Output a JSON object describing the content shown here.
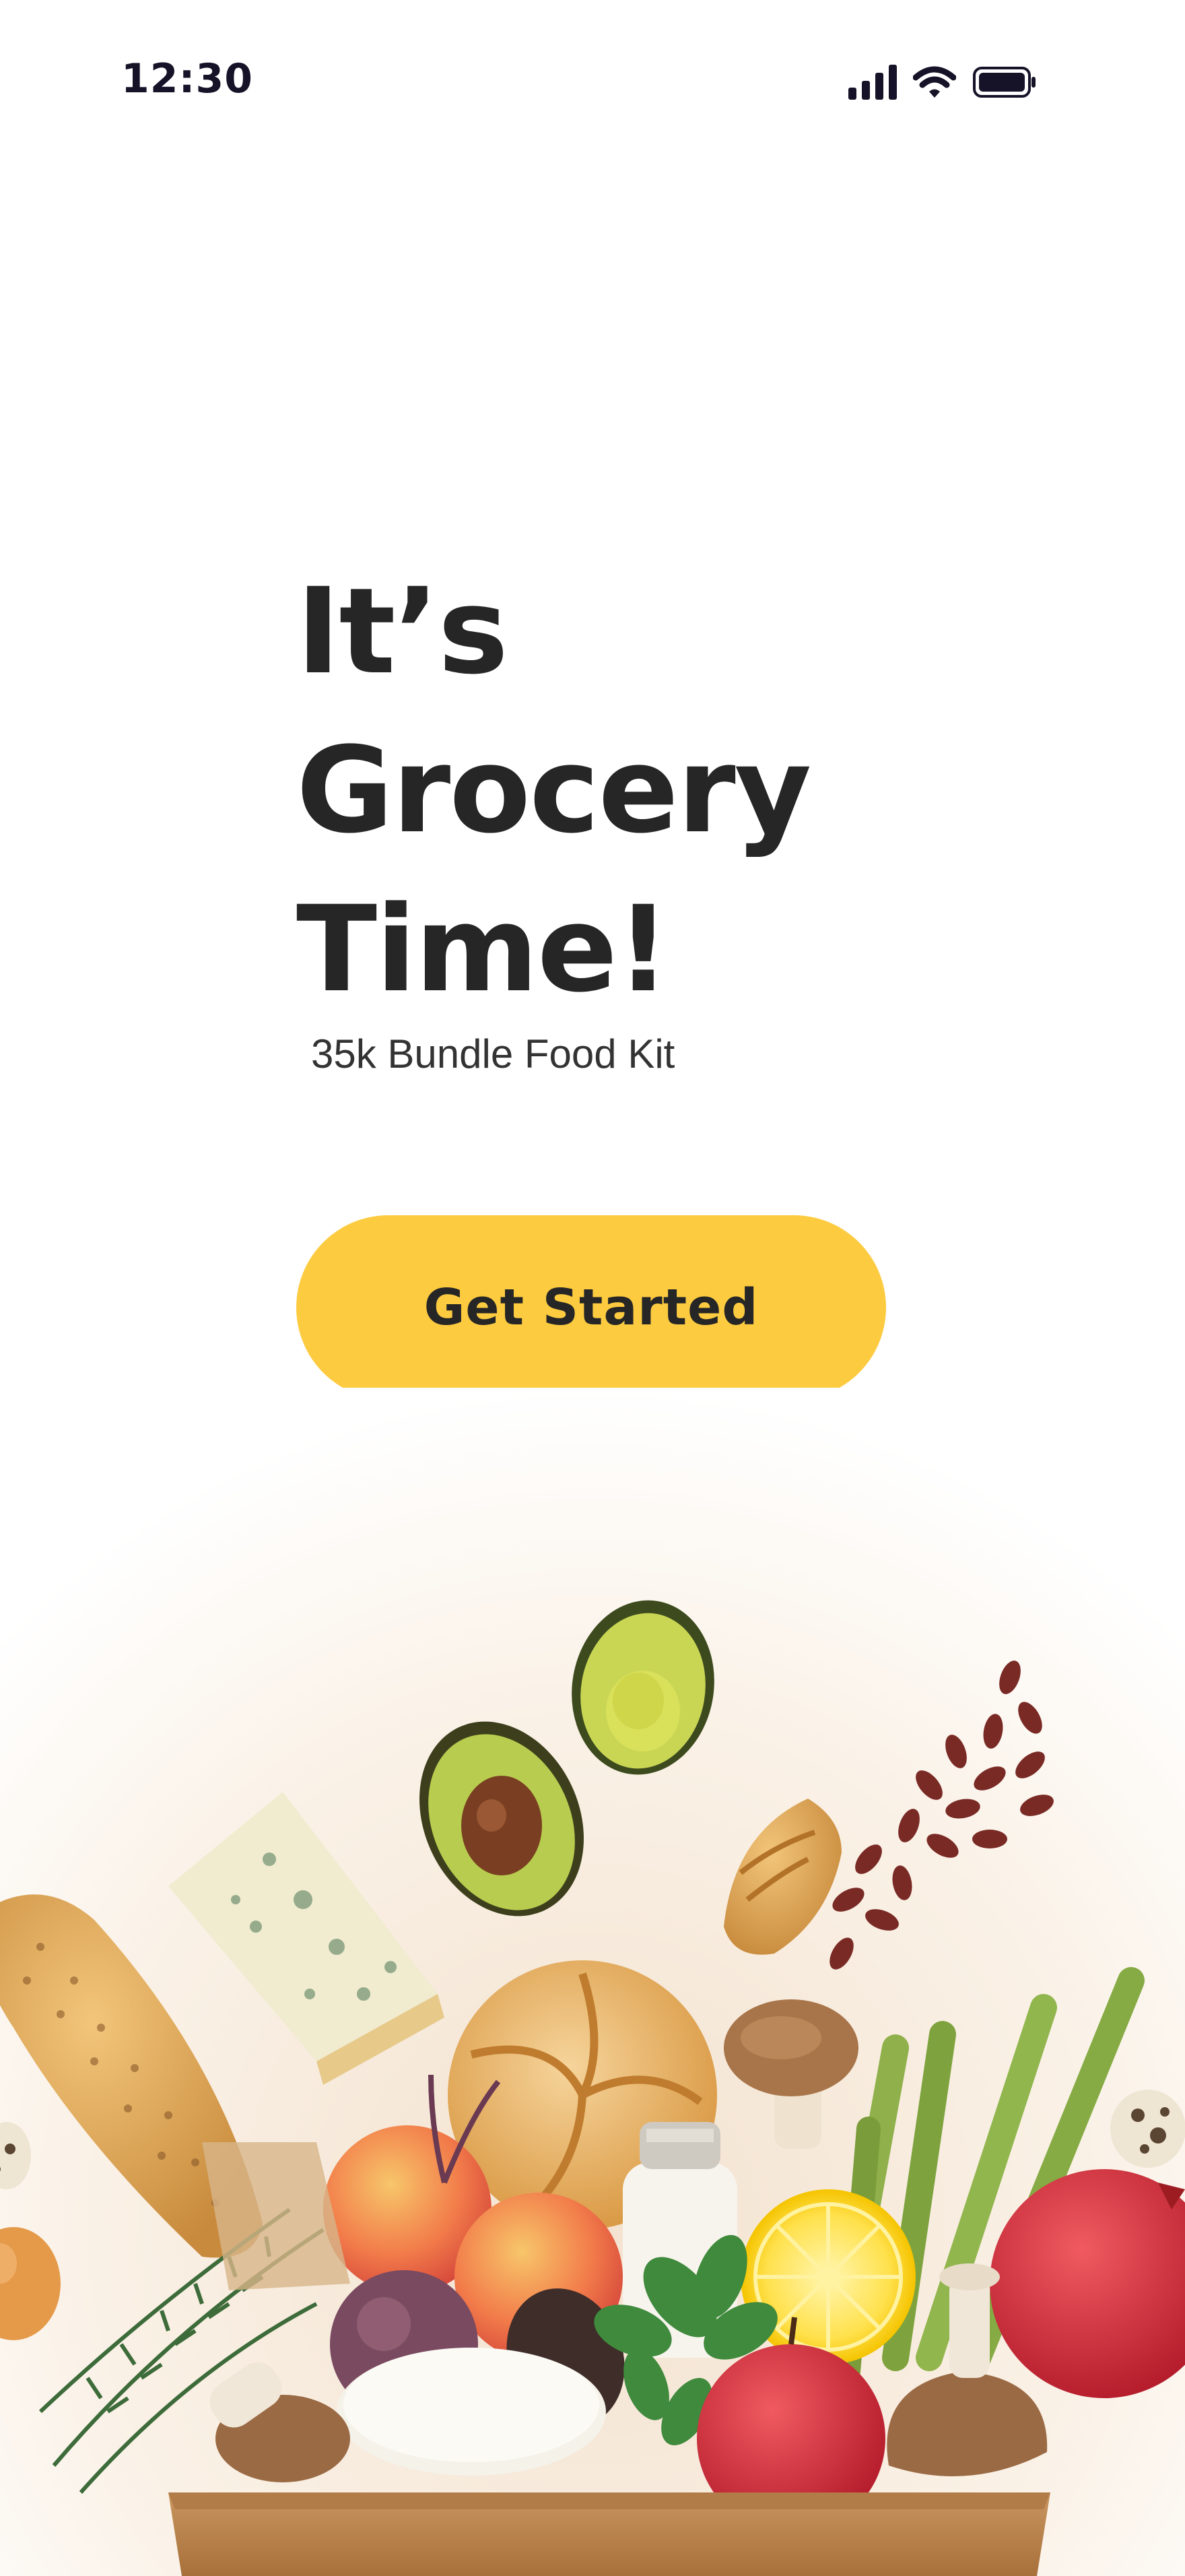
{
  "status_bar": {
    "time": "12:30",
    "icons": [
      "cellular-signal-icon",
      "wifi-icon",
      "battery-icon"
    ]
  },
  "hero": {
    "title_lines": [
      "It’s",
      "Grocery",
      "Time!"
    ],
    "subtitle": "35k Bundle Food Kit"
  },
  "cta": {
    "label": "Get Started",
    "color": "#FDCB40"
  },
  "illustration": {
    "description_icon": "grocery-bag-illustration"
  },
  "colors": {
    "text": "#262626",
    "accent": "#FDCB40",
    "background": "#FFFFFF"
  }
}
